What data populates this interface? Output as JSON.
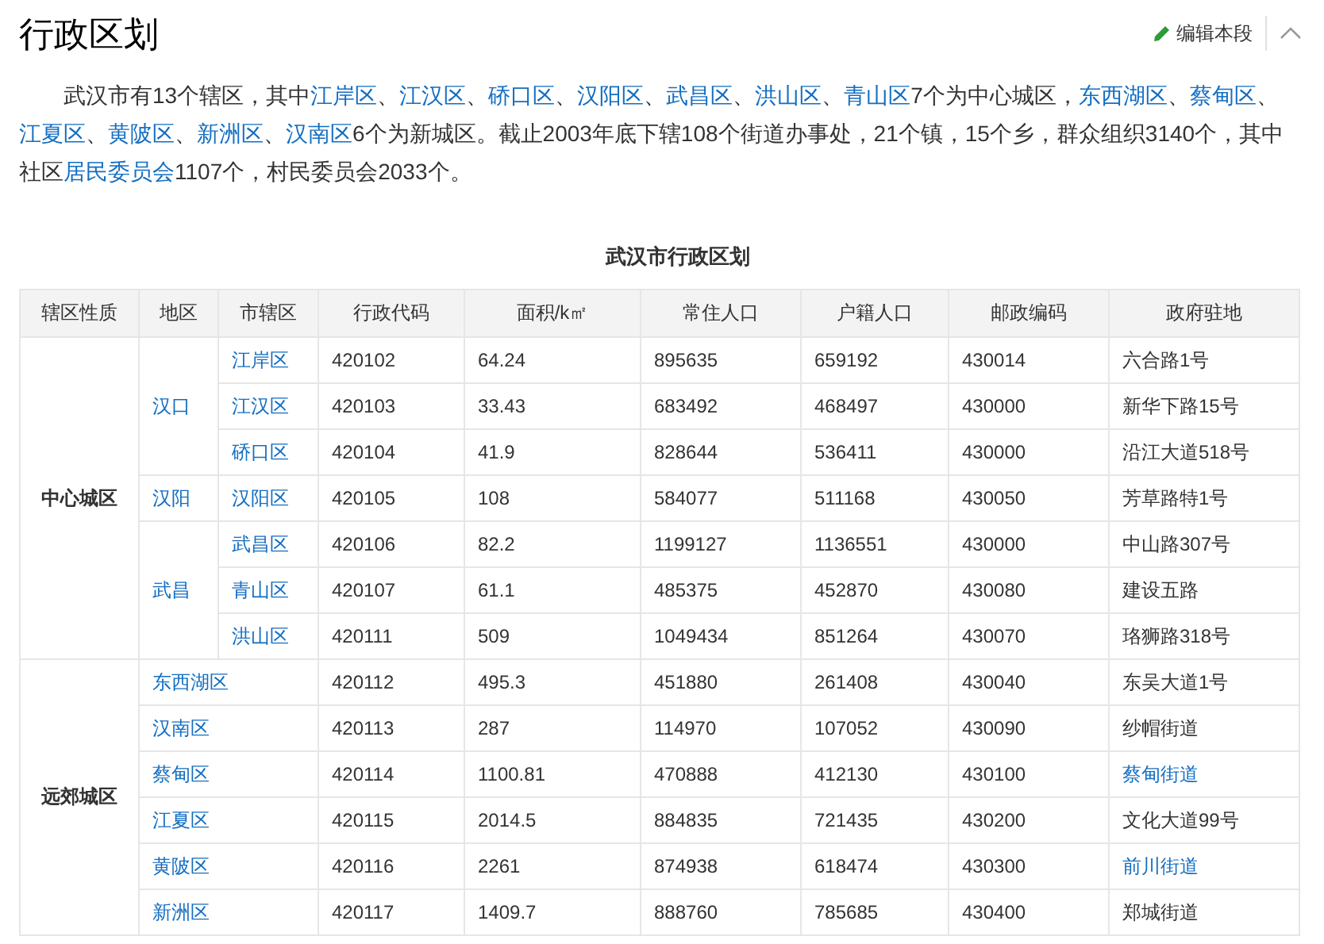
{
  "title": "行政区划",
  "edit_button": "编辑本段",
  "intro": [
    {
      "text": "武汉市有13个辖区，其中",
      "link": false
    },
    {
      "text": "江岸区",
      "link": true
    },
    {
      "text": "、",
      "link": false
    },
    {
      "text": "江汉区",
      "link": true
    },
    {
      "text": "、",
      "link": false
    },
    {
      "text": "硚口区",
      "link": true
    },
    {
      "text": "、",
      "link": false
    },
    {
      "text": "汉阳区",
      "link": true
    },
    {
      "text": "、",
      "link": false
    },
    {
      "text": "武昌区",
      "link": true
    },
    {
      "text": "、",
      "link": false
    },
    {
      "text": "洪山区",
      "link": true
    },
    {
      "text": "、",
      "link": false
    },
    {
      "text": "青山区",
      "link": true
    },
    {
      "text": "7个为中心城区，",
      "link": false
    },
    {
      "text": "东西湖区",
      "link": true
    },
    {
      "text": "、",
      "link": false
    },
    {
      "text": "蔡甸区",
      "link": true
    },
    {
      "text": "、",
      "link": false
    },
    {
      "text": "江夏区",
      "link": true
    },
    {
      "text": "、",
      "link": false
    },
    {
      "text": "黄陂区",
      "link": true
    },
    {
      "text": "、",
      "link": false
    },
    {
      "text": "新洲区",
      "link": true
    },
    {
      "text": "、",
      "link": false
    },
    {
      "text": "汉南区",
      "link": true
    },
    {
      "text": "6个为新城区。截止2003年底下辖108个街道办事处，21个镇，15个乡，群众组织3140个，其中社区",
      "link": false
    },
    {
      "text": "居民委员会",
      "link": true
    },
    {
      "text": "1107个，村民委员会2033个。",
      "link": false
    }
  ],
  "table": {
    "caption": "武汉市行政区划",
    "columns": [
      "辖区性质",
      "地区",
      "市辖区",
      "行政代码",
      "面积/k㎡",
      "常住人口",
      "户籍人口",
      "邮政编码",
      "政府驻地"
    ],
    "groups": [
      {
        "kind": "by_area",
        "nature": "中心城区",
        "areas": [
          {
            "name": "汉口",
            "rows": [
              {
                "district": "江岸区",
                "code": "420102",
                "area": "64.24",
                "resident": "895635",
                "registered": "659192",
                "postcode": "430014",
                "seat": "六合路1号",
                "seat_link": false
              },
              {
                "district": "江汉区",
                "code": "420103",
                "area": "33.43",
                "resident": "683492",
                "registered": "468497",
                "postcode": "430000",
                "seat": "新华下路15号",
                "seat_link": false
              },
              {
                "district": "硚口区",
                "code": "420104",
                "area": "41.9",
                "resident": "828644",
                "registered": "536411",
                "postcode": "430000",
                "seat": "沿江大道518号",
                "seat_link": false
              }
            ]
          },
          {
            "name": "汉阳",
            "rows": [
              {
                "district": "汉阳区",
                "code": "420105",
                "area": "108",
                "resident": "584077",
                "registered": "511168",
                "postcode": "430050",
                "seat": "芳草路特1号",
                "seat_link": false
              }
            ]
          },
          {
            "name": "武昌",
            "rows": [
              {
                "district": "武昌区",
                "code": "420106",
                "area": "82.2",
                "resident": "1199127",
                "registered": "1136551",
                "postcode": "430000",
                "seat": "中山路307号",
                "seat_link": false
              },
              {
                "district": "青山区",
                "code": "420107",
                "area": "61.1",
                "resident": "485375",
                "registered": "452870",
                "postcode": "430080",
                "seat": "建设五路",
                "seat_link": false
              },
              {
                "district": "洪山区",
                "code": "420111",
                "area": "509",
                "resident": "1049434",
                "registered": "851264",
                "postcode": "430070",
                "seat": "珞狮路318号",
                "seat_link": false
              }
            ]
          }
        ]
      },
      {
        "kind": "flat",
        "nature": "远郊城区",
        "rows": [
          {
            "district": "东西湖区",
            "code": "420112",
            "area": "495.3",
            "resident": "451880",
            "registered": "261408",
            "postcode": "430040",
            "seat": "东吴大道1号",
            "seat_link": false
          },
          {
            "district": "汉南区",
            "code": "420113",
            "area": "287",
            "resident": "114970",
            "registered": "107052",
            "postcode": "430090",
            "seat": "纱帽街道",
            "seat_link": false
          },
          {
            "district": "蔡甸区",
            "code": "420114",
            "area": "1100.81",
            "resident": "470888",
            "registered": "412130",
            "postcode": "430100",
            "seat": "蔡甸街道",
            "seat_link": true
          },
          {
            "district": "江夏区",
            "code": "420115",
            "area": "2014.5",
            "resident": "884835",
            "registered": "721435",
            "postcode": "430200",
            "seat": "文化大道99号",
            "seat_link": false
          },
          {
            "district": "黄陂区",
            "code": "420116",
            "area": "2261",
            "resident": "874938",
            "registered": "618474",
            "postcode": "430300",
            "seat": "前川街道",
            "seat_link": true
          },
          {
            "district": "新洲区",
            "code": "420117",
            "area": "1409.7",
            "resident": "888760",
            "registered": "785685",
            "postcode": "430400",
            "seat": "郑城街道",
            "seat_link": false
          }
        ]
      }
    ]
  }
}
